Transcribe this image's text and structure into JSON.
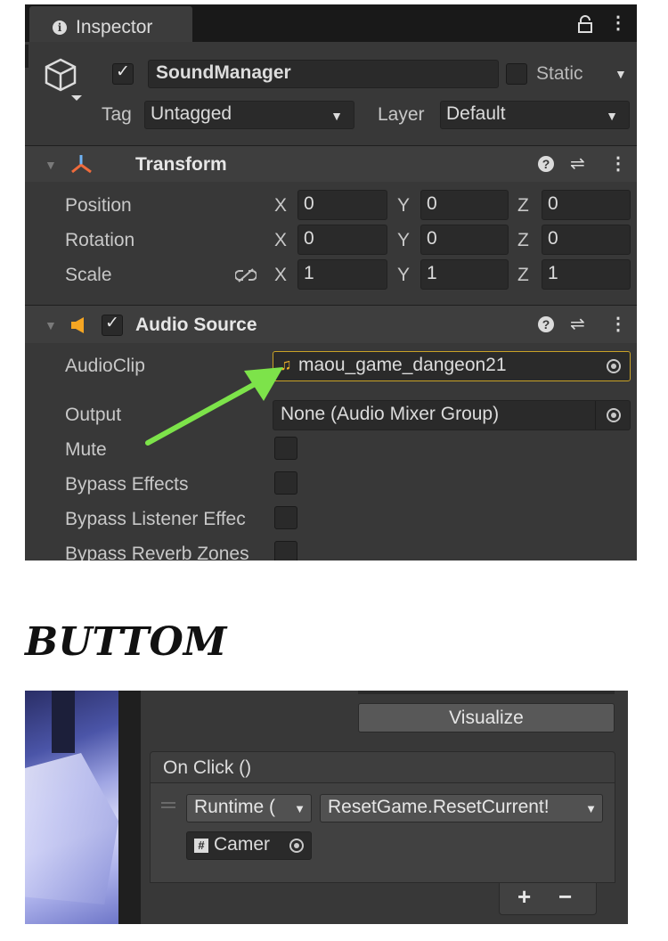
{
  "inspector": {
    "tab_label": "Inspector",
    "object": {
      "name": "SoundManager",
      "active": true,
      "static_label": "Static",
      "static_checked": false,
      "tag_label": "Tag",
      "tag_value": "Untagged",
      "layer_label": "Layer",
      "layer_value": "Default"
    },
    "transform": {
      "title": "Transform",
      "rows": [
        {
          "label": "Position",
          "x": "0",
          "y": "0",
          "z": "0"
        },
        {
          "label": "Rotation",
          "x": "0",
          "y": "0",
          "z": "0"
        },
        {
          "label": "Scale",
          "x": "1",
          "y": "1",
          "z": "1"
        }
      ],
      "axis_x": "X",
      "axis_y": "Y",
      "axis_z": "Z"
    },
    "audio_source": {
      "title": "Audio Source",
      "enabled": true,
      "audioclip_label": "AudioClip",
      "audioclip_value": "maou_game_dangeon21",
      "output_label": "Output",
      "output_value": "None (Audio Mixer Group)",
      "mute_label": "Mute",
      "bypass_effects_label": "Bypass Effects",
      "bypass_listener_label": "Bypass Listener Effec",
      "bypass_reverb_label": "Bypass Reverb Zones"
    },
    "annotation_arrow_color": "#7de34a"
  },
  "section_title": "BUTTOM",
  "button_panel": {
    "visualize_label": "Visualize",
    "onclick_label": "On Click ()",
    "runtime_label": "Runtime (",
    "function_label": "ResetGame.ResetCurrent!",
    "object_label": "Camer",
    "add_label": "+",
    "remove_label": "−"
  }
}
